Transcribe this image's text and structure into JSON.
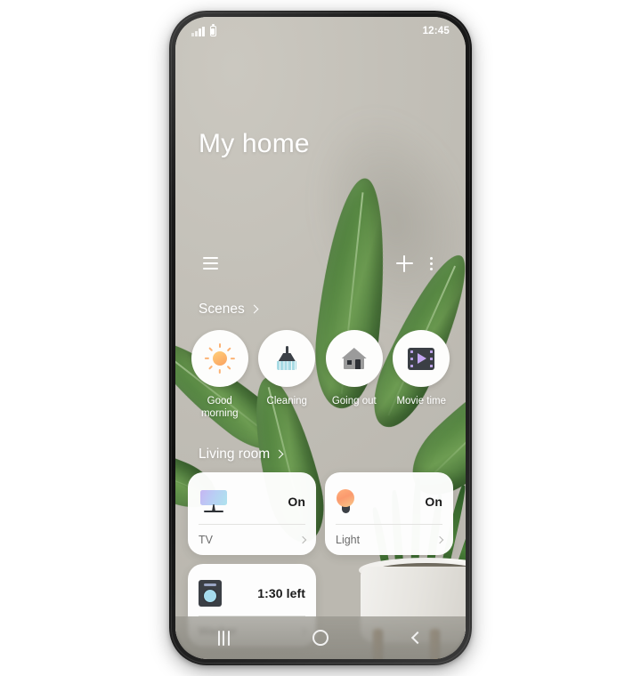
{
  "status_bar": {
    "signal_icon": "signal-bars-icon",
    "battery_icon": "battery-icon",
    "time": "12:45"
  },
  "header": {
    "title": "My home"
  },
  "toolbar": {
    "menu_icon": "hamburger-menu-icon",
    "add_icon": "plus-icon",
    "more_icon": "more-vertical-icon"
  },
  "scenes_section": {
    "label": "Scenes",
    "chevron_icon": "chevron-right-icon",
    "items": [
      {
        "label": "Good\nmorning",
        "label_line1": "Good",
        "label_line2": "morning",
        "icon": "sun-icon"
      },
      {
        "label": "Cleaning",
        "label_line1": "Cleaning",
        "label_line2": "",
        "icon": "broom-icon"
      },
      {
        "label": "Going out",
        "label_line1": "Going out",
        "label_line2": "",
        "icon": "house-icon"
      },
      {
        "label": "Movie time",
        "label_line1": "Movie time",
        "label_line2": "",
        "icon": "film-play-icon"
      }
    ]
  },
  "living_room_section": {
    "label": "Living room",
    "chevron_icon": "chevron-right-icon",
    "devices": [
      {
        "name": "TV",
        "state": "On",
        "icon": "tv-icon",
        "chevron_icon": "chevron-right-icon"
      },
      {
        "name": "Light",
        "state": "On",
        "icon": "light-bulb-icon",
        "chevron_icon": "chevron-right-icon"
      },
      {
        "name": "Washer",
        "state": "1:30 left",
        "icon": "washing-machine-icon",
        "chevron_icon": "chevron-right-icon"
      }
    ]
  },
  "nav_bar": {
    "recents_icon": "recents-icon",
    "home_icon": "home-circle-icon",
    "back_icon": "back-chevron-icon"
  },
  "colors": {
    "background": "#c4c1b9",
    "card": "#ffffff",
    "text_on_wallpaper": "#ffffff",
    "card_label": "#6c6c6c",
    "accent_bulb": "#fb9a6e",
    "accent_film": "#c4a6f2",
    "leaf_green": "#52833f"
  }
}
